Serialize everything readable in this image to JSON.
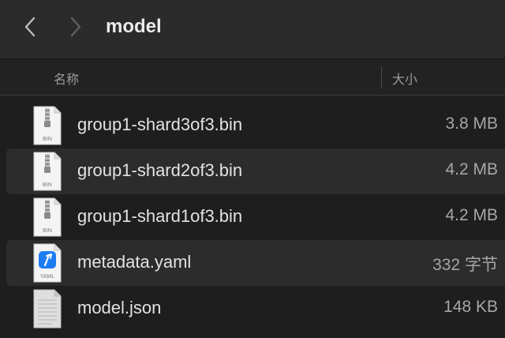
{
  "window": {
    "title": "model"
  },
  "toolbar": {
    "back_icon": "chevron-left-icon",
    "forward_icon": "chevron-right-icon"
  },
  "columns": {
    "name": "名称",
    "size": "大小"
  },
  "files": [
    {
      "name": "group1-shard3of3.bin",
      "size": "3.8 MB",
      "icon": "binary-file-icon",
      "icon_label": "BIN"
    },
    {
      "name": "group1-shard2of3.bin",
      "size": "4.2 MB",
      "icon": "binary-file-icon",
      "icon_label": "BIN"
    },
    {
      "name": "group1-shard1of3.bin",
      "size": "4.2 MB",
      "icon": "binary-file-icon",
      "icon_label": "BIN"
    },
    {
      "name": "metadata.yaml",
      "size": "332 字节",
      "icon": "yaml-file-icon",
      "icon_label": "YAML"
    },
    {
      "name": "model.json",
      "size": "148 KB",
      "icon": "json-file-icon",
      "icon_label": ""
    }
  ],
  "colors": {
    "yaml_accent": "#1e7cf2",
    "row_alt": "#2c2c2c"
  }
}
